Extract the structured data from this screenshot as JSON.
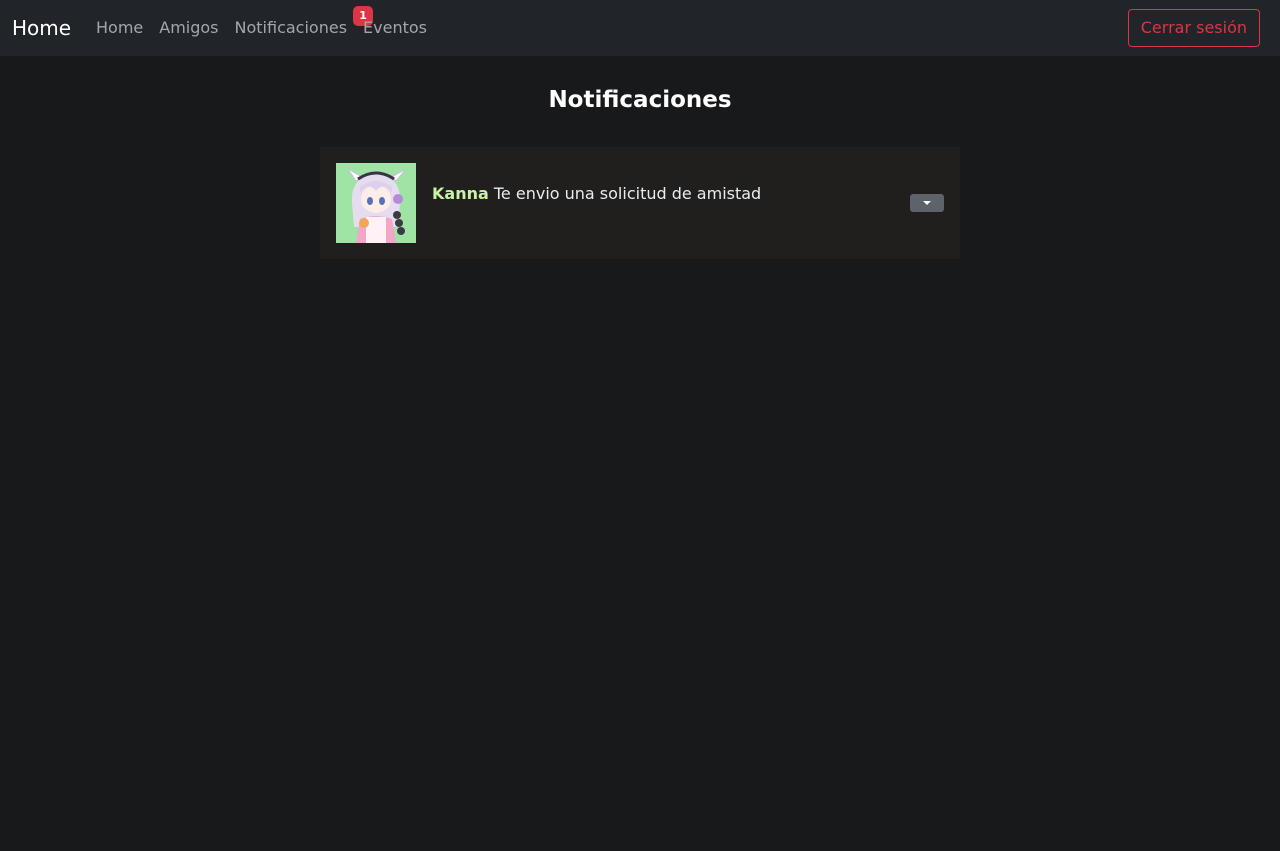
{
  "navbar": {
    "brand": "Home",
    "links": [
      {
        "label": "Home"
      },
      {
        "label": "Amigos"
      },
      {
        "label": "Notificaciones",
        "badge": "1"
      },
      {
        "label": "Eventos"
      }
    ],
    "logout_label": "Cerrar sesión"
  },
  "main": {
    "title": "Notificaciones",
    "notifications": [
      {
        "user": "Kanna",
        "message": "Te envio una solicitud de amistad",
        "avatar_icon": "user-avatar"
      }
    ]
  },
  "colors": {
    "background": "#18191b",
    "navbar": "#212429",
    "danger": "#dc3545",
    "username": "#c9f2a8",
    "card": "#201f1d"
  }
}
